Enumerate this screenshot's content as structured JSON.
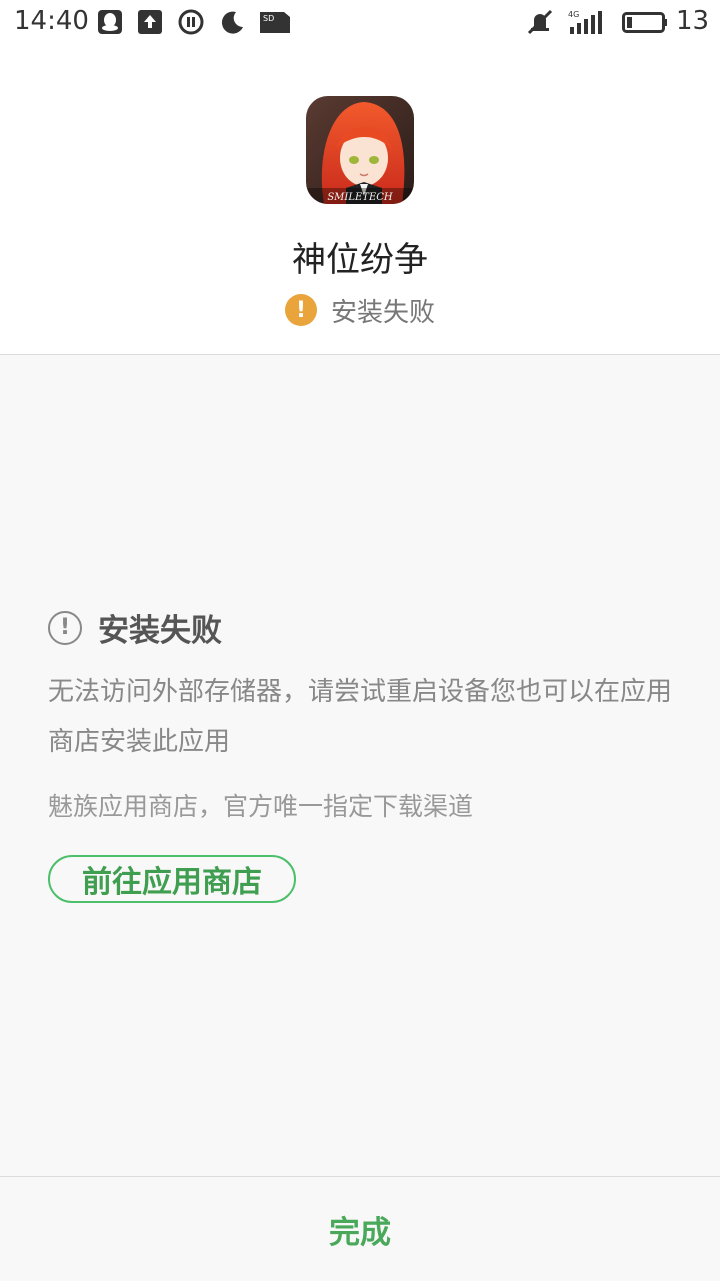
{
  "status_bar": {
    "time": "14:40",
    "battery_level": "13",
    "network_type": "4G",
    "icons": [
      "qq-icon",
      "upload-icon",
      "pause-icon",
      "moon-icon",
      "sd-card-icon",
      "mute-icon",
      "signal-icon",
      "battery-icon"
    ]
  },
  "app": {
    "name": "神位纷争",
    "icon_text": "SMILETECH",
    "install_status": "安装失败"
  },
  "error": {
    "title": "安装失败",
    "description": "无法访问外部存储器，请尝试重启设备您也可以在应用商店安装此应用",
    "store_note": "魅族应用商店，官方唯一指定下载渠道",
    "store_button_label": "前往应用商店"
  },
  "footer": {
    "done_label": "完成"
  },
  "colors": {
    "warning": "#e9a43b",
    "accent_green": "#4aa85a",
    "content_bg": "#f8f8f8"
  }
}
